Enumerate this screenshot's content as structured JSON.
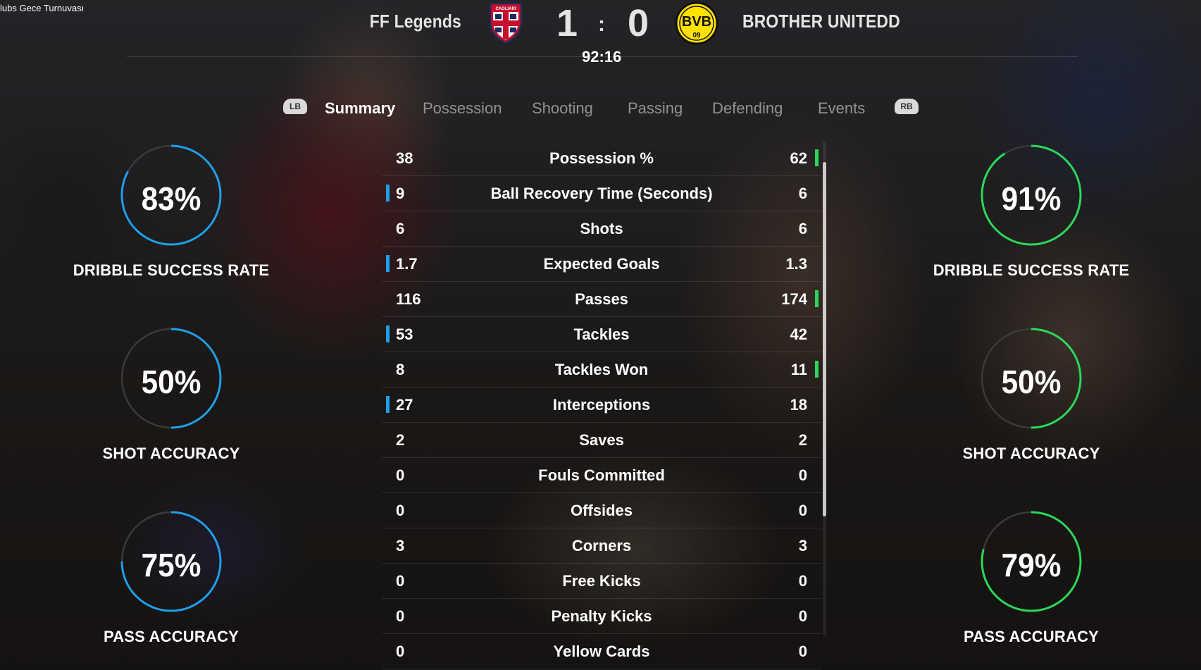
{
  "window": {
    "corner_title": "lubs Gece Turnuvası"
  },
  "match": {
    "home_team": "FF Legends",
    "away_team": "BROTHER UNITEDD",
    "home_score": "1",
    "away_score": "0",
    "separator": ":",
    "clock": "92:16",
    "home_crest_text": "CAGLIARI",
    "away_crest_text": "BVB",
    "away_crest_sub": "09"
  },
  "tabs": {
    "lb_label": "LB",
    "rb_label": "RB",
    "items": [
      {
        "label": "Summary",
        "active": true
      },
      {
        "label": "Possession",
        "active": false
      },
      {
        "label": "Shooting",
        "active": false
      },
      {
        "label": "Passing",
        "active": false
      },
      {
        "label": "Defending",
        "active": false
      },
      {
        "label": "Events",
        "active": false
      }
    ]
  },
  "stats": [
    {
      "name": "Possession %",
      "home": "38",
      "away": "62",
      "leader": "away"
    },
    {
      "name": "Ball Recovery Time (Seconds)",
      "home": "9",
      "away": "6",
      "leader": "home"
    },
    {
      "name": "Shots",
      "home": "6",
      "away": "6",
      "leader": "none"
    },
    {
      "name": "Expected Goals",
      "home": "1.7",
      "away": "1.3",
      "leader": "home"
    },
    {
      "name": "Passes",
      "home": "116",
      "away": "174",
      "leader": "away"
    },
    {
      "name": "Tackles",
      "home": "53",
      "away": "42",
      "leader": "home"
    },
    {
      "name": "Tackles Won",
      "home": "8",
      "away": "11",
      "leader": "away"
    },
    {
      "name": "Interceptions",
      "home": "27",
      "away": "18",
      "leader": "home"
    },
    {
      "name": "Saves",
      "home": "2",
      "away": "2",
      "leader": "none"
    },
    {
      "name": "Fouls Committed",
      "home": "0",
      "away": "0",
      "leader": "none"
    },
    {
      "name": "Offsides",
      "home": "0",
      "away": "0",
      "leader": "none"
    },
    {
      "name": "Corners",
      "home": "3",
      "away": "3",
      "leader": "none"
    },
    {
      "name": "Free Kicks",
      "home": "0",
      "away": "0",
      "leader": "none"
    },
    {
      "name": "Penalty Kicks",
      "home": "0",
      "away": "0",
      "leader": "none"
    },
    {
      "name": "Yellow Cards",
      "home": "0",
      "away": "0",
      "leader": "none"
    }
  ],
  "gauges": {
    "home": [
      {
        "label": "DRIBBLE SUCCESS RATE",
        "value_text": "83%",
        "value": 83
      },
      {
        "label": "SHOT ACCURACY",
        "value_text": "50%",
        "value": 50
      },
      {
        "label": "PASS ACCURACY",
        "value_text": "75%",
        "value": 75
      }
    ],
    "away": [
      {
        "label": "DRIBBLE SUCCESS RATE",
        "value_text": "91%",
        "value": 91
      },
      {
        "label": "SHOT ACCURACY",
        "value_text": "50%",
        "value": 50
      },
      {
        "label": "PASS ACCURACY",
        "value_text": "79%",
        "value": 79
      }
    ]
  },
  "colors": {
    "home_accent": "#1e9fea",
    "away_accent": "#2bd85a",
    "gauge_track": "#3a3a3a"
  }
}
